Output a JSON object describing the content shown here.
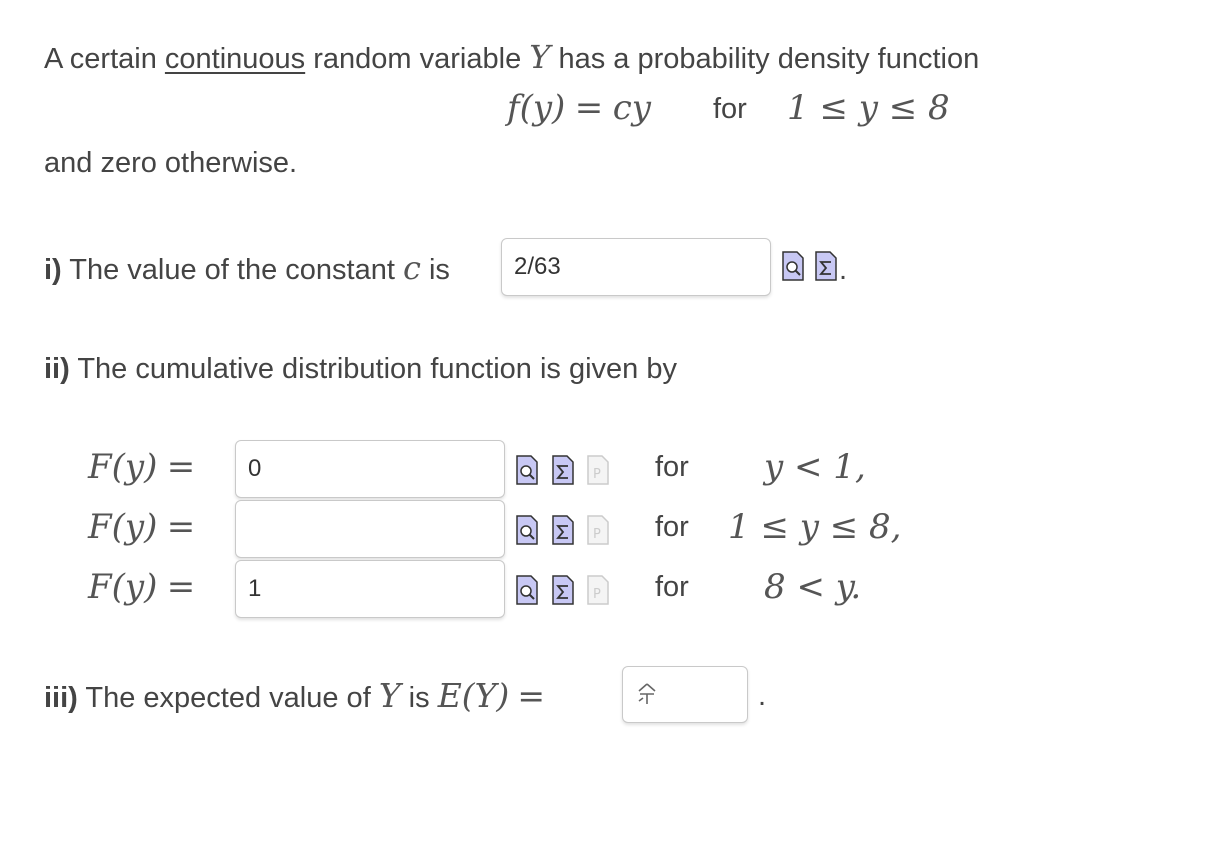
{
  "intro": {
    "prefix": "A certain",
    "underlined": "continuous",
    "middle": "random variable",
    "var": "Y",
    "suffix": "has a probability density function"
  },
  "pdf": {
    "lhs": "f(y)",
    "eq": "=",
    "rhs": "cy",
    "for": "for",
    "range": "1 ≤ y ≤ 8"
  },
  "otherwise": "and zero otherwise.",
  "part1": {
    "label": "i)",
    "text": "The value of the constant",
    "var": "c",
    "is": "is",
    "value": "2/63",
    "period": "."
  },
  "part2": {
    "label": "ii)",
    "text": "The cumulative distribution function is given by",
    "rows": [
      {
        "lhs": "F(y)",
        "eq": "=",
        "value": "0",
        "for": "for",
        "cond": "y < 1,"
      },
      {
        "lhs": "F(y)",
        "eq": "=",
        "value": "",
        "for": "for",
        "cond": "1 ≤ y ≤ 8,"
      },
      {
        "lhs": "F(y)",
        "eq": "=",
        "value": "1",
        "for": "for",
        "cond": "8 < y."
      }
    ]
  },
  "part3": {
    "label": "iii)",
    "text": "The expected value of",
    "var": "Y",
    "is": "is",
    "expr": "E(Y)",
    "eq": "=",
    "value": "",
    "period": "."
  },
  "icons": {
    "preview": "preview-icon",
    "equation": "sigma-equation-icon",
    "problem": "problem-page-icon",
    "ime": "ime-icon"
  },
  "colors": {
    "icon_fill": "#c8c8f4",
    "icon_stroke": "#333333",
    "text": "#444444"
  }
}
